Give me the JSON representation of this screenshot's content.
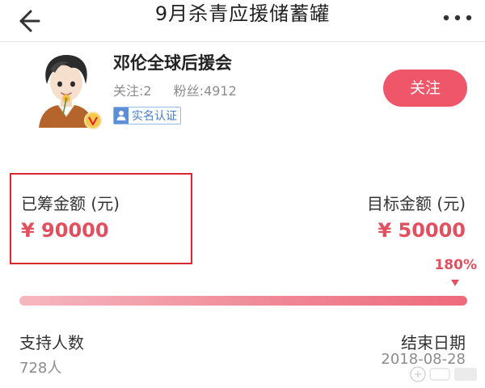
{
  "header": {
    "title": "9月杀青应援储蓄罐",
    "back_icon": "back-arrow-icon",
    "more_icon": "more-dots-icon"
  },
  "profile": {
    "name": "邓伦全球后援会",
    "follow_count_text": "关注:2",
    "fans_count_text": "粉丝:4912",
    "verified_label": "实名认证",
    "follow_button": "关注",
    "badge_icon": "v-badge-icon"
  },
  "funding": {
    "raised_label": "已筹金额 (元)",
    "raised_value": "¥ 90000",
    "target_label": "目标金额 (元)",
    "target_value": "¥ 50000",
    "percent_text": "180%",
    "progress_fraction": 1.0
  },
  "info": {
    "supporters_label": "支持人数",
    "supporters_value": "728人",
    "end_label": "结束日期",
    "end_value": "2018-08-28"
  },
  "colors": {
    "accent": "#e2505f",
    "follow_button": "#f0566a",
    "highlight_box": "#d9282f",
    "verify_blue": "#5b8fd8"
  }
}
